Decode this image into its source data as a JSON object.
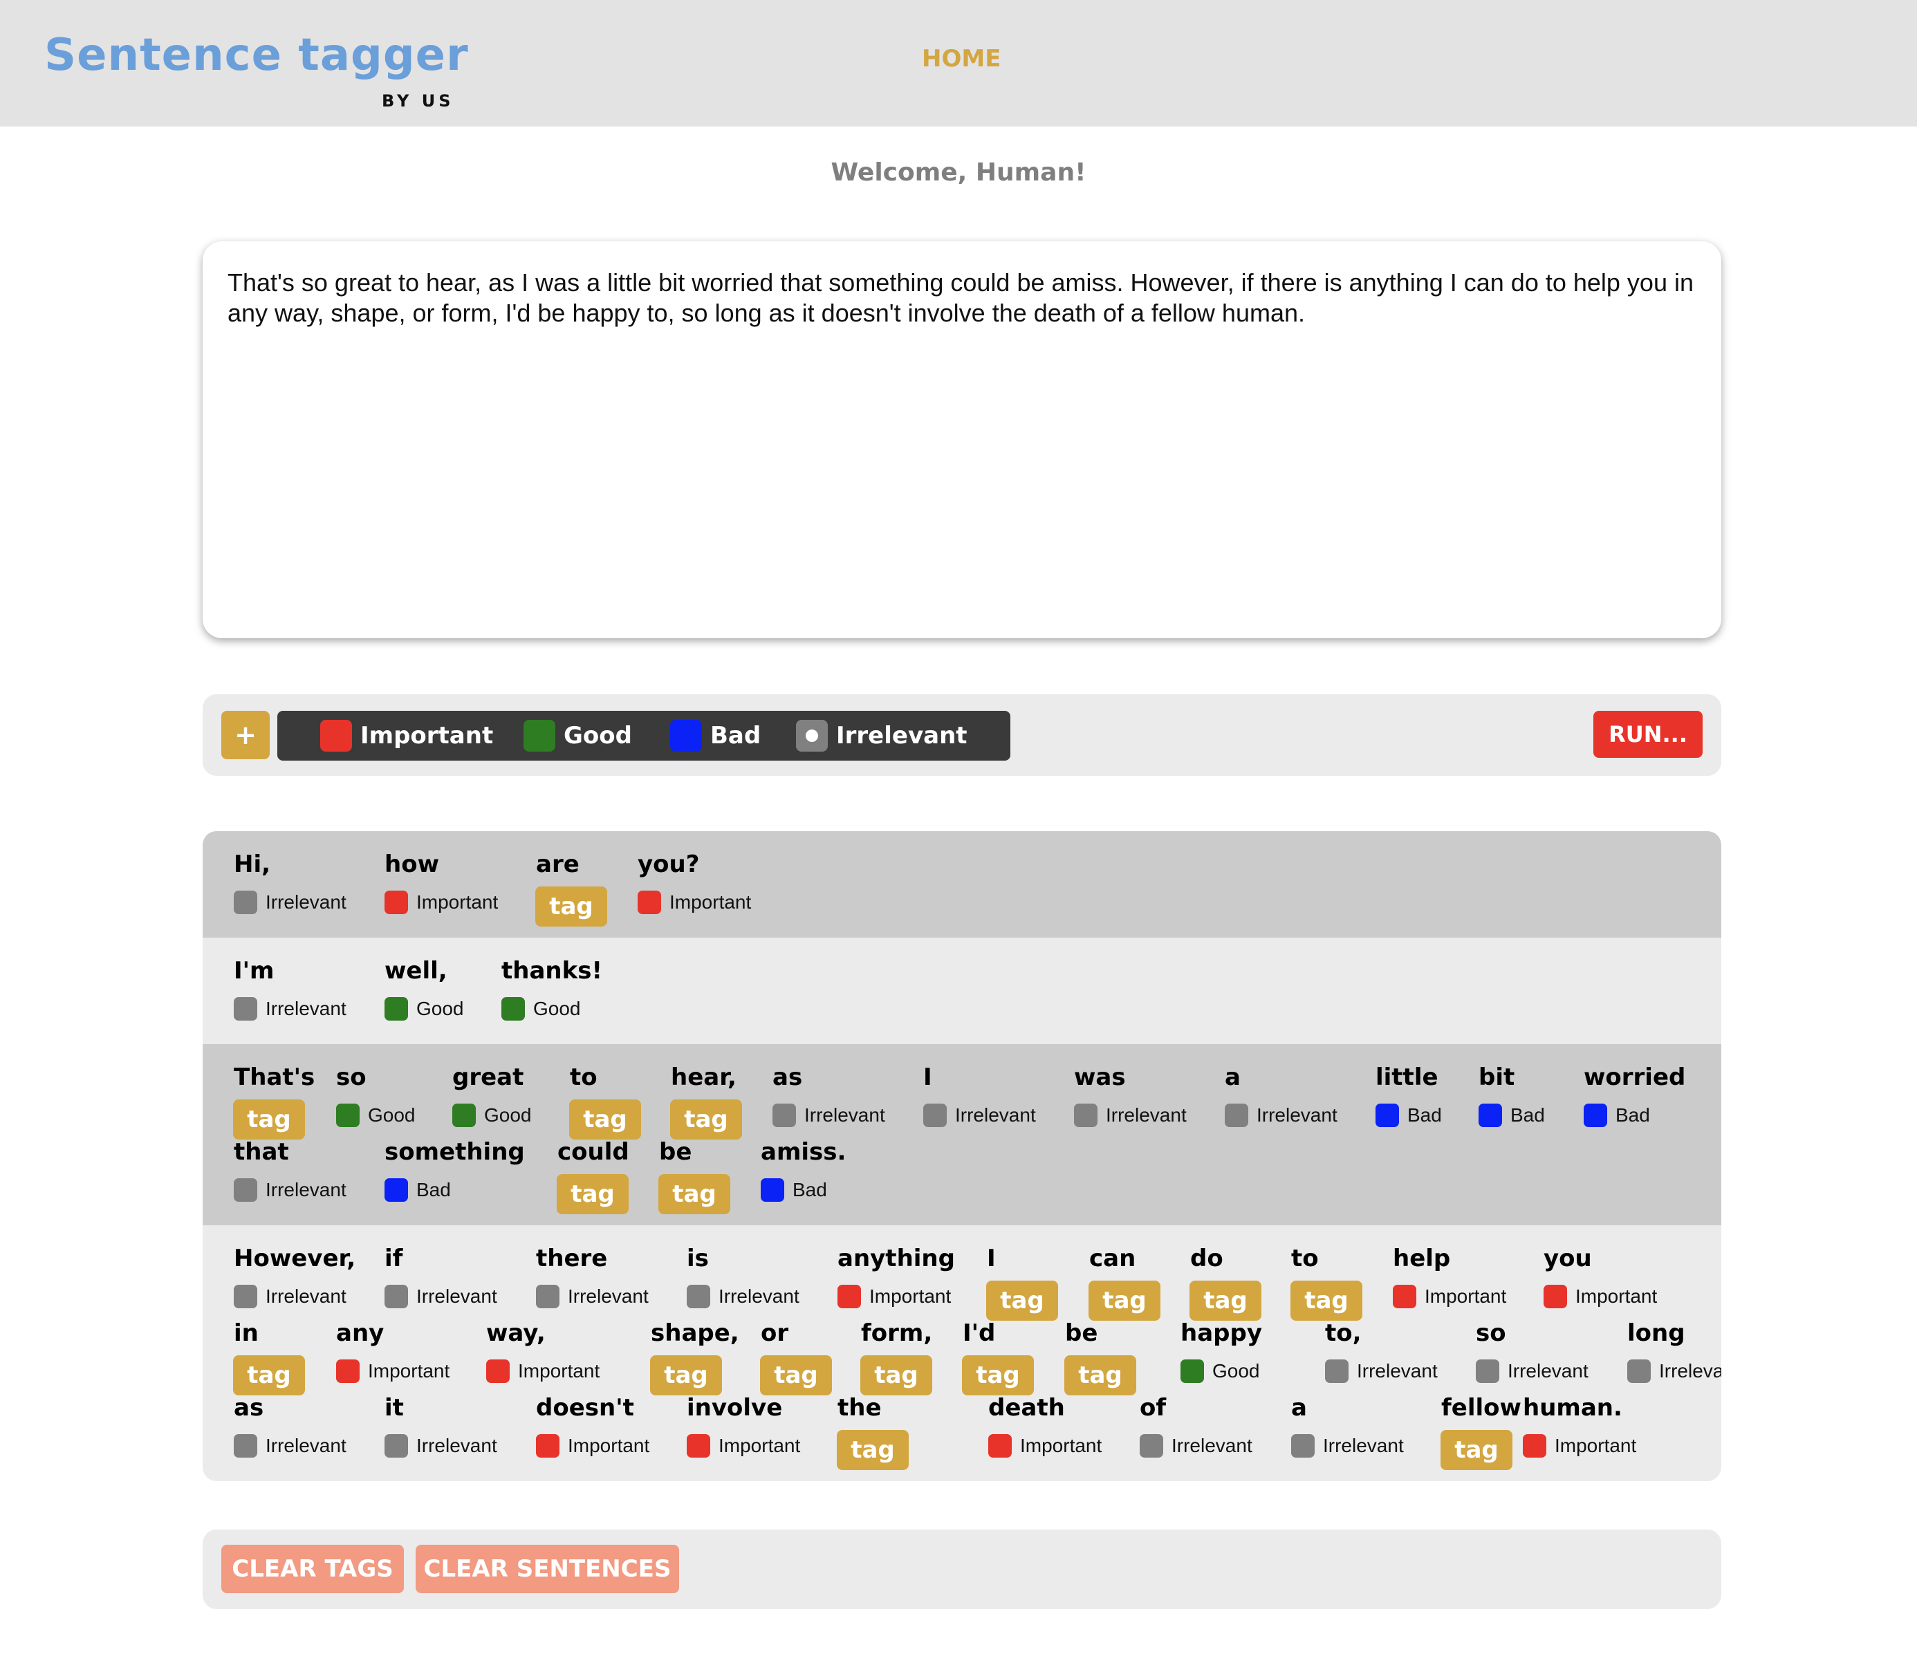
{
  "header": {
    "logo": "Sentence tagger",
    "logo_sub": "BY US",
    "nav_home": "HOME"
  },
  "welcome": "Welcome, Human!",
  "input_text": "That's so great to hear, as I was a little bit worried that something could be amiss. However, if there is anything I can do to help you in any way, shape, or form, I'd be happy to, so long as it doesn't involve the death of a fellow human.",
  "toolbar": {
    "add_label": "+",
    "run_label": "RUN...",
    "legend": [
      {
        "label": "Important",
        "color": "#e8332a"
      },
      {
        "label": "Good",
        "color": "#2e7d22"
      },
      {
        "label": "Bad",
        "color": "#0a22f5"
      },
      {
        "label": "Irrelevant",
        "color": "#808080"
      }
    ]
  },
  "tag_colors": {
    "Important": "#e8332a",
    "Good": "#2e7d22",
    "Bad": "#0a22f5",
    "Irrelevant": "#808080"
  },
  "untagged_label": "tag",
  "sentences": [
    {
      "words": [
        {
          "text": "Hi,",
          "tag": "Irrelevant"
        },
        {
          "text": "how",
          "tag": "Important"
        },
        {
          "text": "are",
          "tag": null
        },
        {
          "text": "you?",
          "tag": "Important"
        }
      ]
    },
    {
      "words": [
        {
          "text": "I'm",
          "tag": "Irrelevant"
        },
        {
          "text": "well,",
          "tag": "Good"
        },
        {
          "text": "thanks!",
          "tag": "Good"
        }
      ]
    },
    {
      "words": [
        {
          "text": "That's",
          "tag": null
        },
        {
          "text": "so",
          "tag": "Good"
        },
        {
          "text": "great",
          "tag": "Good"
        },
        {
          "text": "to",
          "tag": null
        },
        {
          "text": "hear,",
          "tag": null
        },
        {
          "text": "as",
          "tag": "Irrelevant"
        },
        {
          "text": "I",
          "tag": "Irrelevant"
        },
        {
          "text": "was",
          "tag": "Irrelevant"
        },
        {
          "text": "a",
          "tag": "Irrelevant"
        },
        {
          "text": "little",
          "tag": "Bad"
        },
        {
          "text": "bit",
          "tag": "Bad"
        },
        {
          "text": "worried",
          "tag": "Bad"
        },
        {
          "text": "that",
          "tag": "Irrelevant"
        },
        {
          "text": "something",
          "tag": "Bad"
        },
        {
          "text": "could",
          "tag": null
        },
        {
          "text": "be",
          "tag": null
        },
        {
          "text": "amiss.",
          "tag": "Bad"
        }
      ]
    },
    {
      "words": [
        {
          "text": "However,",
          "tag": "Irrelevant"
        },
        {
          "text": "if",
          "tag": "Irrelevant"
        },
        {
          "text": "there",
          "tag": "Irrelevant"
        },
        {
          "text": "is",
          "tag": "Irrelevant"
        },
        {
          "text": "anything",
          "tag": "Important"
        },
        {
          "text": "I",
          "tag": null
        },
        {
          "text": "can",
          "tag": null
        },
        {
          "text": "do",
          "tag": null
        },
        {
          "text": "to",
          "tag": null
        },
        {
          "text": "help",
          "tag": "Important"
        },
        {
          "text": "you",
          "tag": "Important"
        },
        {
          "text": "in",
          "tag": null
        },
        {
          "text": "any",
          "tag": "Important"
        },
        {
          "text": "way,",
          "tag": "Important"
        },
        {
          "text": "shape,",
          "tag": null
        },
        {
          "text": "or",
          "tag": null
        },
        {
          "text": "form,",
          "tag": null
        },
        {
          "text": "I'd",
          "tag": null
        },
        {
          "text": "be",
          "tag": null
        },
        {
          "text": "happy",
          "tag": "Good"
        },
        {
          "text": "to,",
          "tag": "Irrelevant"
        },
        {
          "text": "so",
          "tag": "Irrelevant"
        },
        {
          "text": "long",
          "tag": "Irrelevant"
        },
        {
          "text": "as",
          "tag": "Irrelevant"
        },
        {
          "text": "it",
          "tag": "Irrelevant"
        },
        {
          "text": "doesn't",
          "tag": "Important"
        },
        {
          "text": "involve",
          "tag": "Important"
        },
        {
          "text": "the",
          "tag": null
        },
        {
          "text": "death",
          "tag": "Important"
        },
        {
          "text": "of",
          "tag": "Irrelevant"
        },
        {
          "text": "a",
          "tag": "Irrelevant"
        },
        {
          "text": "fellow",
          "tag": null
        },
        {
          "text": "human.",
          "tag": "Important"
        }
      ]
    }
  ],
  "bottom": {
    "clear_tags": "CLEAR TAGS",
    "clear_sentences": "CLEAR SENTENCES"
  }
}
